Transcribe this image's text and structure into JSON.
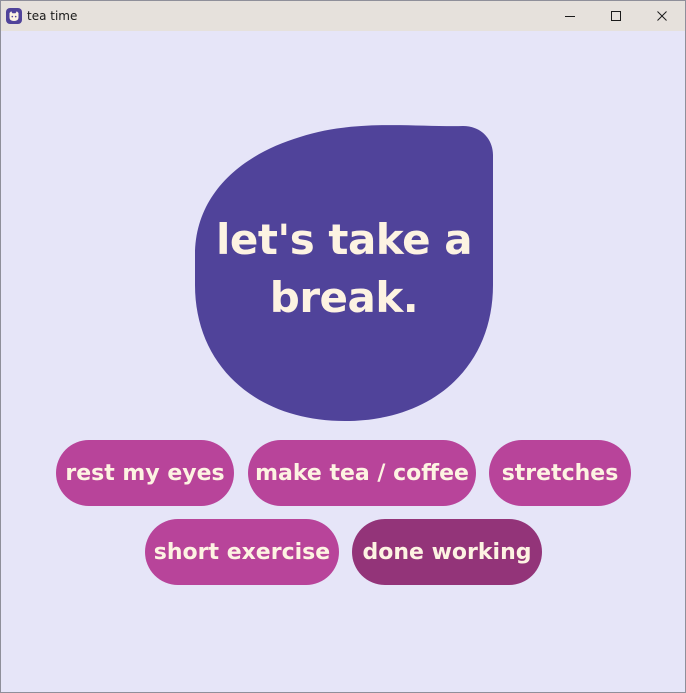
{
  "window": {
    "title": "tea time",
    "app_icon": "cat-face-icon",
    "controls": {
      "minimize": "minimize-icon",
      "maximize": "maximize-icon",
      "close": "close-icon"
    }
  },
  "main": {
    "headline_line1": "let's take a",
    "headline_line2": "break."
  },
  "options": [
    {
      "label": "rest my eyes"
    },
    {
      "label": "make tea / coffee"
    },
    {
      "label": "stretches"
    },
    {
      "label": "short exercise"
    },
    {
      "label": "done working"
    }
  ],
  "colors": {
    "background": "#e6e5f8",
    "blob": "#50439a",
    "pill": "#b8449a",
    "pill_done": "#933479",
    "text_light": "#fdf3e2",
    "titlebar": "#e6e1dc"
  }
}
